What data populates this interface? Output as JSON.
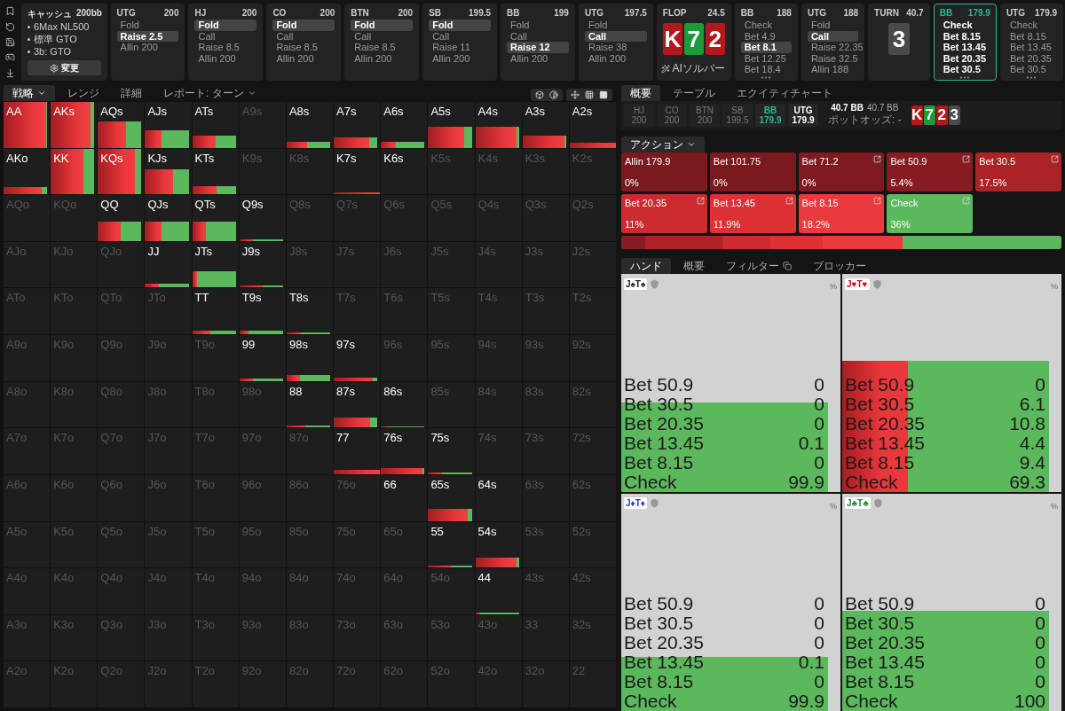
{
  "info": {
    "title": "キャッシュ",
    "stack": "200bb",
    "items": [
      "6Max NL500",
      "標準 GTO",
      "3b: GTO"
    ],
    "button": "変更"
  },
  "nodes": [
    {
      "kind": "actions",
      "pos": "UTG",
      "stack": "200",
      "current": false,
      "more": false,
      "actions": [
        {
          "label": "Fold",
          "selected": false
        },
        {
          "label": "Raise 2.5",
          "selected": true
        },
        {
          "label": "Allin 200",
          "selected": false
        }
      ]
    },
    {
      "kind": "actions",
      "pos": "HJ",
      "stack": "200",
      "current": false,
      "more": false,
      "actions": [
        {
          "label": "Fold",
          "selected": true
        },
        {
          "label": "Call",
          "selected": false
        },
        {
          "label": "Raise 8.5",
          "selected": false
        },
        {
          "label": "Allin 200",
          "selected": false
        }
      ]
    },
    {
      "kind": "actions",
      "pos": "CO",
      "stack": "200",
      "current": false,
      "more": false,
      "actions": [
        {
          "label": "Fold",
          "selected": true
        },
        {
          "label": "Call",
          "selected": false
        },
        {
          "label": "Raise 8.5",
          "selected": false
        },
        {
          "label": "Allin 200",
          "selected": false
        }
      ]
    },
    {
      "kind": "actions",
      "pos": "BTN",
      "stack": "200",
      "current": false,
      "more": false,
      "actions": [
        {
          "label": "Fold",
          "selected": true
        },
        {
          "label": "Call",
          "selected": false
        },
        {
          "label": "Raise 8.5",
          "selected": false
        },
        {
          "label": "Allin 200",
          "selected": false
        }
      ]
    },
    {
      "kind": "actions",
      "pos": "SB",
      "stack": "199.5",
      "current": false,
      "more": false,
      "actions": [
        {
          "label": "Fold",
          "selected": true
        },
        {
          "label": "Call",
          "selected": false
        },
        {
          "label": "Raise 11",
          "selected": false
        },
        {
          "label": "Allin 200",
          "selected": false
        }
      ]
    },
    {
      "kind": "actions",
      "pos": "BB",
      "stack": "199",
      "current": false,
      "more": false,
      "actions": [
        {
          "label": "Fold",
          "selected": false
        },
        {
          "label": "Call",
          "selected": false
        },
        {
          "label": "Raise 12",
          "selected": true
        },
        {
          "label": "Allin 200",
          "selected": false
        }
      ]
    },
    {
      "kind": "actions",
      "pos": "UTG",
      "stack": "197.5",
      "current": false,
      "more": false,
      "actions": [
        {
          "label": "Fold",
          "selected": false
        },
        {
          "label": "Call",
          "selected": true
        },
        {
          "label": "Raise 38",
          "selected": false
        },
        {
          "label": "Allin 200",
          "selected": false
        }
      ]
    },
    {
      "kind": "board",
      "pos": "FLOP",
      "stack": "24.5",
      "button": "AIソルバー",
      "cards": [
        {
          "rank": "K",
          "color": "#b3181c"
        },
        {
          "rank": "7",
          "color": "#1d9a3a"
        },
        {
          "rank": "2",
          "color": "#b3181c"
        }
      ]
    },
    {
      "kind": "actions",
      "pos": "BB",
      "stack": "188",
      "current": false,
      "more": true,
      "actions": [
        {
          "label": "Check",
          "selected": false
        },
        {
          "label": "Bet 4.9",
          "selected": false
        },
        {
          "label": "Bet 8.1",
          "selected": true
        },
        {
          "label": "Bet 12.25",
          "selected": false
        },
        {
          "label": "Bet 18.4",
          "selected": false
        }
      ]
    },
    {
      "kind": "actions",
      "pos": "UTG",
      "stack": "188",
      "current": false,
      "more": false,
      "actions": [
        {
          "label": "Fold",
          "selected": false
        },
        {
          "label": "Call",
          "selected": true
        },
        {
          "label": "Raise 22.35",
          "selected": false
        },
        {
          "label": "Raise 32.5",
          "selected": false
        },
        {
          "label": "Allin 188",
          "selected": false
        }
      ]
    },
    {
      "kind": "board",
      "pos": "TURN",
      "stack": "40.7",
      "cards": [
        {
          "rank": "3",
          "color": "#4a4a4a"
        }
      ]
    },
    {
      "kind": "actions",
      "pos": "BB",
      "stack": "179.9",
      "current": true,
      "more": true,
      "actions": [
        {
          "label": "Check",
          "selected": false
        },
        {
          "label": "Bet 8.15",
          "selected": false
        },
        {
          "label": "Bet 13.45",
          "selected": false
        },
        {
          "label": "Bet 20.35",
          "selected": false
        },
        {
          "label": "Bet 30.5",
          "selected": false
        }
      ]
    },
    {
      "kind": "actions",
      "pos": "UTG",
      "stack": "179.9",
      "current": false,
      "more": true,
      "actions": [
        {
          "label": "Check",
          "selected": false
        },
        {
          "label": "Bet 8.15",
          "selected": false
        },
        {
          "label": "Bet 13.45",
          "selected": false
        },
        {
          "label": "Bet 20.35",
          "selected": false
        },
        {
          "label": "Bet 30.5",
          "selected": false
        }
      ]
    }
  ],
  "left_tabs": [
    {
      "label": "戦略",
      "selected": true,
      "dropdown": true
    },
    {
      "label": "レンジ",
      "selected": false,
      "dropdown": false
    },
    {
      "label": "詳細",
      "selected": false,
      "dropdown": false
    },
    {
      "label": "レポート: ターン",
      "selected": false,
      "dropdown": true
    }
  ],
  "grid": [
    [
      {
        "hand": "AA",
        "active": true,
        "level": 1,
        "bet": {
          "level": 0.93
        }
      },
      {
        "hand": "AKs",
        "active": true,
        "level": 1,
        "bet": {
          "level": 0.86
        }
      },
      {
        "hand": "AQs",
        "active": true,
        "level": 0.58,
        "bet": {
          "level": 0.6
        }
      },
      {
        "hand": "AJs",
        "active": true,
        "level": 0.38,
        "bet": {
          "level": 0.35
        }
      },
      {
        "hand": "ATs",
        "active": true,
        "level": 0.27,
        "bet": {
          "level": 0.5
        }
      },
      {
        "hand": "A9s",
        "active": false
      },
      {
        "hand": "A8s",
        "active": true,
        "level": 0.13,
        "bet": {
          "level": 0.45
        }
      },
      {
        "hand": "A7s",
        "active": true,
        "level": 0.22,
        "bet": {
          "level": 0.77
        }
      },
      {
        "hand": "A6s",
        "active": true,
        "level": 0.13,
        "bet": {
          "level": 0.33
        }
      },
      {
        "hand": "A5s",
        "active": true,
        "level": 0.45,
        "bet": {
          "level": 0.77
        }
      },
      {
        "hand": "A4s",
        "active": true,
        "level": 0.45,
        "bet": {
          "level": 0.9
        }
      },
      {
        "hand": "A3s",
        "active": true,
        "level": 0.27,
        "bet": {
          "level": 0.9
        }
      },
      {
        "hand": "A2s",
        "active": true,
        "level": 0.1,
        "bet": {
          "level": 1
        }
      }
    ],
    [
      {
        "hand": "AKo",
        "active": true,
        "level": 0.16,
        "bet": {
          "level": 0.82
        }
      },
      {
        "hand": "KK",
        "active": true,
        "level": 1,
        "bet": {
          "level": 0.7
        }
      },
      {
        "hand": "KQs",
        "active": true,
        "level": 1,
        "bet": {
          "level": 0.8
        }
      },
      {
        "hand": "KJs",
        "active": true,
        "level": 0.55,
        "bet": {
          "level": 0.6
        }
      },
      {
        "hand": "KTs",
        "active": true,
        "level": 0.18,
        "bet": {
          "level": 0.52
        }
      },
      {
        "hand": "K9s",
        "active": false
      },
      {
        "hand": "K8s",
        "active": false
      },
      {
        "hand": "K7s",
        "active": true,
        "level": 0.04,
        "bet": {
          "level": 1
        }
      },
      {
        "hand": "K6s",
        "active": true
      },
      {
        "hand": "K5s",
        "active": false
      },
      {
        "hand": "K4s",
        "active": false
      },
      {
        "hand": "K3s",
        "active": false
      },
      {
        "hand": "K2s",
        "active": false
      }
    ],
    [
      {
        "hand": "AQo",
        "active": false
      },
      {
        "hand": "KQo",
        "active": false
      },
      {
        "hand": "QQ",
        "active": true,
        "level": 0.42,
        "bet": {
          "level": 0.5
        }
      },
      {
        "hand": "QJs",
        "active": true,
        "level": 0.42,
        "bet": {
          "level": 0.35
        }
      },
      {
        "hand": "QTs",
        "active": true,
        "level": 0.42,
        "bet": {
          "level": 0.3
        }
      },
      {
        "hand": "Q9s",
        "active": true,
        "level": 0.04,
        "bet": {
          "level": 0.3
        }
      },
      {
        "hand": "Q8s",
        "active": false
      },
      {
        "hand": "Q7s",
        "active": false
      },
      {
        "hand": "Q6s",
        "active": false
      },
      {
        "hand": "Q5s",
        "active": false
      },
      {
        "hand": "Q4s",
        "active": false
      },
      {
        "hand": "Q3s",
        "active": false
      },
      {
        "hand": "Q2s",
        "active": false
      }
    ],
    [
      {
        "hand": "AJo",
        "active": false
      },
      {
        "hand": "KJo",
        "active": false
      },
      {
        "hand": "QJo",
        "active": false
      },
      {
        "hand": "JJ",
        "active": true,
        "level": 0.08,
        "bet": {
          "level": 0.3
        }
      },
      {
        "hand": "JTs",
        "active": true,
        "level": 0.35,
        "bet": {
          "level": 0.1
        }
      },
      {
        "hand": "J9s",
        "active": true,
        "level": 0.04,
        "bet": {
          "level": 0.5
        }
      },
      {
        "hand": "J8s",
        "active": false
      },
      {
        "hand": "J7s",
        "active": false
      },
      {
        "hand": "J6s",
        "active": false
      },
      {
        "hand": "J5s",
        "active": false
      },
      {
        "hand": "J4s",
        "active": false
      },
      {
        "hand": "J3s",
        "active": false
      },
      {
        "hand": "J2s",
        "active": false
      }
    ],
    [
      {
        "hand": "ATo",
        "active": false
      },
      {
        "hand": "KTo",
        "active": false
      },
      {
        "hand": "QTo",
        "active": false
      },
      {
        "hand": "JTo",
        "active": false
      },
      {
        "hand": "TT",
        "active": true,
        "level": 0.08,
        "bet": {
          "level": 0.4
        }
      },
      {
        "hand": "T9s",
        "active": true,
        "level": 0.08,
        "bet": {
          "level": 0.2
        }
      },
      {
        "hand": "T8s",
        "active": true,
        "level": 0.04,
        "bet": {
          "level": 0.3
        }
      },
      {
        "hand": "T7s",
        "active": false
      },
      {
        "hand": "T6s",
        "active": false
      },
      {
        "hand": "T5s",
        "active": false
      },
      {
        "hand": "T4s",
        "active": false
      },
      {
        "hand": "T3s",
        "active": false
      },
      {
        "hand": "T2s",
        "active": false
      }
    ],
    [
      {
        "hand": "A9o",
        "active": false
      },
      {
        "hand": "K9o",
        "active": false
      },
      {
        "hand": "Q9o",
        "active": false
      },
      {
        "hand": "J9o",
        "active": false
      },
      {
        "hand": "T9o",
        "active": false
      },
      {
        "hand": "99",
        "active": true,
        "level": 0.05,
        "bet": {
          "level": 0.3
        }
      },
      {
        "hand": "98s",
        "active": true,
        "level": 0.13,
        "bet": {
          "level": 0.28
        }
      },
      {
        "hand": "97s",
        "active": true,
        "level": 0.08,
        "bet": {
          "level": 0.85
        }
      },
      {
        "hand": "96s",
        "active": false
      },
      {
        "hand": "95s",
        "active": false
      },
      {
        "hand": "94s",
        "active": false
      },
      {
        "hand": "93s",
        "active": false
      },
      {
        "hand": "92s",
        "active": false
      }
    ],
    [
      {
        "hand": "A8o",
        "active": false
      },
      {
        "hand": "K8o",
        "active": false
      },
      {
        "hand": "Q8o",
        "active": false
      },
      {
        "hand": "J8o",
        "active": false
      },
      {
        "hand": "T8o",
        "active": false
      },
      {
        "hand": "98o",
        "active": false
      },
      {
        "hand": "88",
        "active": true,
        "level": 0.04,
        "bet": {
          "level": 0.4
        }
      },
      {
        "hand": "87s",
        "active": true,
        "level": 0.22,
        "bet": {
          "level": 0.78
        }
      },
      {
        "hand": "86s",
        "active": true,
        "level": 0.03,
        "bet": {
          "level": 0.15
        }
      },
      {
        "hand": "85s",
        "active": false
      },
      {
        "hand": "84s",
        "active": false
      },
      {
        "hand": "83s",
        "active": false
      },
      {
        "hand": "82s",
        "active": false
      }
    ],
    [
      {
        "hand": "A7o",
        "active": false
      },
      {
        "hand": "K7o",
        "active": false
      },
      {
        "hand": "Q7o",
        "active": false
      },
      {
        "hand": "J7o",
        "active": false
      },
      {
        "hand": "T7o",
        "active": false
      },
      {
        "hand": "97o",
        "active": false
      },
      {
        "hand": "87o",
        "active": false
      },
      {
        "hand": "77",
        "active": true,
        "level": 0.1,
        "bet": {
          "level": 1
        }
      },
      {
        "hand": "76s",
        "active": true,
        "level": 0.13,
        "bet": {
          "level": 0.9
        }
      },
      {
        "hand": "75s",
        "active": true,
        "level": 0.03,
        "bet": {
          "level": 0.3
        }
      },
      {
        "hand": "74s",
        "active": false
      },
      {
        "hand": "73s",
        "active": false
      },
      {
        "hand": "72s",
        "active": false
      }
    ],
    [
      {
        "hand": "A6o",
        "active": false
      },
      {
        "hand": "K6o",
        "active": false
      },
      {
        "hand": "Q6o",
        "active": false
      },
      {
        "hand": "J6o",
        "active": false
      },
      {
        "hand": "T6o",
        "active": false
      },
      {
        "hand": "96o",
        "active": false
      },
      {
        "hand": "86o",
        "active": false
      },
      {
        "hand": "76o",
        "active": false
      },
      {
        "hand": "66",
        "active": true
      },
      {
        "hand": "65s",
        "active": true,
        "level": 0.26,
        "bet": {
          "level": 0.85
        }
      },
      {
        "hand": "64s",
        "active": true
      },
      {
        "hand": "63s",
        "active": false
      },
      {
        "hand": "62s",
        "active": false
      }
    ],
    [
      {
        "hand": "A5o",
        "active": false
      },
      {
        "hand": "K5o",
        "active": false
      },
      {
        "hand": "Q5o",
        "active": false
      },
      {
        "hand": "J5o",
        "active": false
      },
      {
        "hand": "T5o",
        "active": false
      },
      {
        "hand": "95o",
        "active": false
      },
      {
        "hand": "85o",
        "active": false
      },
      {
        "hand": "75o",
        "active": false
      },
      {
        "hand": "65o",
        "active": false
      },
      {
        "hand": "55",
        "active": true,
        "level": 0.05,
        "bet": {
          "level": 0.5
        }
      },
      {
        "hand": "54s",
        "active": true,
        "level": 0.22,
        "bet": {
          "level": 0.9
        }
      },
      {
        "hand": "53s",
        "active": false
      },
      {
        "hand": "52s",
        "active": false
      }
    ],
    [
      {
        "hand": "A4o",
        "active": false
      },
      {
        "hand": "K4o",
        "active": false
      },
      {
        "hand": "Q4o",
        "active": false
      },
      {
        "hand": "J4o",
        "active": false
      },
      {
        "hand": "T4o",
        "active": false
      },
      {
        "hand": "94o",
        "active": false
      },
      {
        "hand": "84o",
        "active": false
      },
      {
        "hand": "74o",
        "active": false
      },
      {
        "hand": "64o",
        "active": false
      },
      {
        "hand": "54o",
        "active": false
      },
      {
        "hand": "44",
        "active": true,
        "level": 0.03,
        "bet": {
          "level": 0.1
        }
      },
      {
        "hand": "43s",
        "active": false
      },
      {
        "hand": "42s",
        "active": false
      }
    ],
    [
      {
        "hand": "A3o",
        "active": false
      },
      {
        "hand": "K3o",
        "active": false
      },
      {
        "hand": "Q3o",
        "active": false
      },
      {
        "hand": "J3o",
        "active": false
      },
      {
        "hand": "T3o",
        "active": false
      },
      {
        "hand": "93o",
        "active": false
      },
      {
        "hand": "83o",
        "active": false
      },
      {
        "hand": "73o",
        "active": false
      },
      {
        "hand": "63o",
        "active": false
      },
      {
        "hand": "53o",
        "active": false
      },
      {
        "hand": "43o",
        "active": false
      },
      {
        "hand": "33",
        "active": false
      },
      {
        "hand": "32s",
        "active": false
      }
    ],
    [
      {
        "hand": "A2o",
        "active": false
      },
      {
        "hand": "K2o",
        "active": false
      },
      {
        "hand": "Q2o",
        "active": false
      },
      {
        "hand": "J2o",
        "active": false
      },
      {
        "hand": "T2o",
        "active": false
      },
      {
        "hand": "92o",
        "active": false
      },
      {
        "hand": "82o",
        "active": false
      },
      {
        "hand": "72o",
        "active": false
      },
      {
        "hand": "62o",
        "active": false
      },
      {
        "hand": "52o",
        "active": false
      },
      {
        "hand": "42o",
        "active": false
      },
      {
        "hand": "32o",
        "active": false
      },
      {
        "hand": "22",
        "active": false
      }
    ]
  ],
  "right_tabs": [
    {
      "label": "概要",
      "selected": true
    },
    {
      "label": "テーブル",
      "selected": false
    },
    {
      "label": "エクイティチャート",
      "selected": false
    }
  ],
  "players": [
    {
      "pos": "HJ",
      "stack": "200",
      "folded": true,
      "selected": false
    },
    {
      "pos": "CO",
      "stack": "200",
      "folded": true,
      "selected": false
    },
    {
      "pos": "BTN",
      "stack": "200",
      "folded": true,
      "selected": false
    },
    {
      "pos": "SB",
      "stack": "199.5",
      "folded": true,
      "selected": false
    },
    {
      "pos": "BB",
      "stack": "179.9",
      "folded": false,
      "selected": true
    },
    {
      "pos": "UTG",
      "stack": "179.9",
      "folded": false,
      "selected": false
    }
  ],
  "pot": {
    "main": "40.7 BB",
    "secondary": "40.7 BB",
    "odds": "ポットオッズ: -"
  },
  "board": [
    {
      "rank": "K",
      "color": "#b3181c"
    },
    {
      "rank": "7",
      "color": "#1d9a3a"
    },
    {
      "rank": "2",
      "color": "#b3181c"
    },
    {
      "rank": "3",
      "color": "#4a4a4a"
    }
  ],
  "actions_tab": {
    "label": "アクション"
  },
  "actions": [
    {
      "label": "Allin 179.9",
      "percent": "0%",
      "color": "#7a1a1e",
      "detail": false
    },
    {
      "label": "Bet 101.75",
      "percent": "0%",
      "color": "#7a1a1e",
      "detail": false
    },
    {
      "label": "Bet 71.2",
      "percent": "0%",
      "color": "#7f1b20",
      "detail": true
    },
    {
      "label": "Bet 50.9",
      "percent": "5.4%",
      "color": "#861c21",
      "detail": true,
      "level": 0.054
    },
    {
      "label": "Bet 30.5",
      "percent": "17.5%",
      "color": "#a92327",
      "detail": true,
      "level": 0.175
    },
    {
      "label": "Bet 20.35",
      "percent": "11%",
      "color": "#cc2b2f",
      "detail": true,
      "level": 0.11
    },
    {
      "label": "Bet 13.45",
      "percent": "11.9%",
      "color": "#dc3236",
      "detail": true,
      "level": 0.119
    },
    {
      "label": "Bet 8.15",
      "percent": "18.2%",
      "color": "#ea3a3e",
      "detail": true,
      "level": 0.182
    },
    {
      "label": "Check",
      "percent": "36%",
      "color": "#5cb85c",
      "detail": true,
      "level": 0.36
    }
  ],
  "hand_tabs": [
    {
      "label": "ハンド",
      "selected": true,
      "icon": false
    },
    {
      "label": "概要",
      "selected": false,
      "icon": false
    },
    {
      "label": "フィルター",
      "selected": false,
      "icon": true
    },
    {
      "label": "ブロッカー",
      "selected": false,
      "icon": false
    }
  ],
  "combos": [
    {
      "combo": "J♠T♠",
      "color": "#222222",
      "unit": "%",
      "level": 0.41,
      "rows": [
        {
          "label": "Bet 50.9",
          "value": "0"
        },
        {
          "label": "Bet 30.5",
          "value": "0"
        },
        {
          "label": "Bet 20.35",
          "value": "0"
        },
        {
          "label": "Bet 13.45",
          "value": "0.1"
        },
        {
          "label": "Bet 8.15",
          "value": "0"
        },
        {
          "label": "Check",
          "value": "99.9"
        }
      ]
    },
    {
      "combo": "J♥T♥",
      "color": "#c0141a",
      "unit": "%",
      "level": 0.6,
      "bet": {
        "level": 0.3
      },
      "rows": [
        {
          "label": "Bet 50.9",
          "value": "0"
        },
        {
          "label": "Bet 30.5",
          "value": "6.1"
        },
        {
          "label": "Bet 20.35",
          "value": "10.8"
        },
        {
          "label": "Bet 13.45",
          "value": "4.4"
        },
        {
          "label": "Bet 8.15",
          "value": "9.4"
        },
        {
          "label": "Check",
          "value": "69.3"
        }
      ]
    },
    {
      "combo": "J♦T♦",
      "color": "#1f3fc0",
      "unit": "%",
      "level": 0.25,
      "rows": [
        {
          "label": "Bet 50.9",
          "value": "0"
        },
        {
          "label": "Bet 30.5",
          "value": "0"
        },
        {
          "label": "Bet 20.35",
          "value": "0"
        },
        {
          "label": "Bet 13.45",
          "value": "0.1"
        },
        {
          "label": "Bet 8.15",
          "value": "0"
        },
        {
          "label": "Check",
          "value": "99.9"
        }
      ]
    },
    {
      "combo": "J♣T♣",
      "color": "#1d8a33",
      "unit": "%",
      "level": 0.46,
      "rows": [
        {
          "label": "Bet 50.9",
          "value": "0"
        },
        {
          "label": "Bet 30.5",
          "value": "0"
        },
        {
          "label": "Bet 20.35",
          "value": "0"
        },
        {
          "label": "Bet 13.45",
          "value": "0"
        },
        {
          "label": "Bet 8.15",
          "value": "0"
        },
        {
          "label": "Check",
          "value": "100"
        }
      ]
    }
  ]
}
